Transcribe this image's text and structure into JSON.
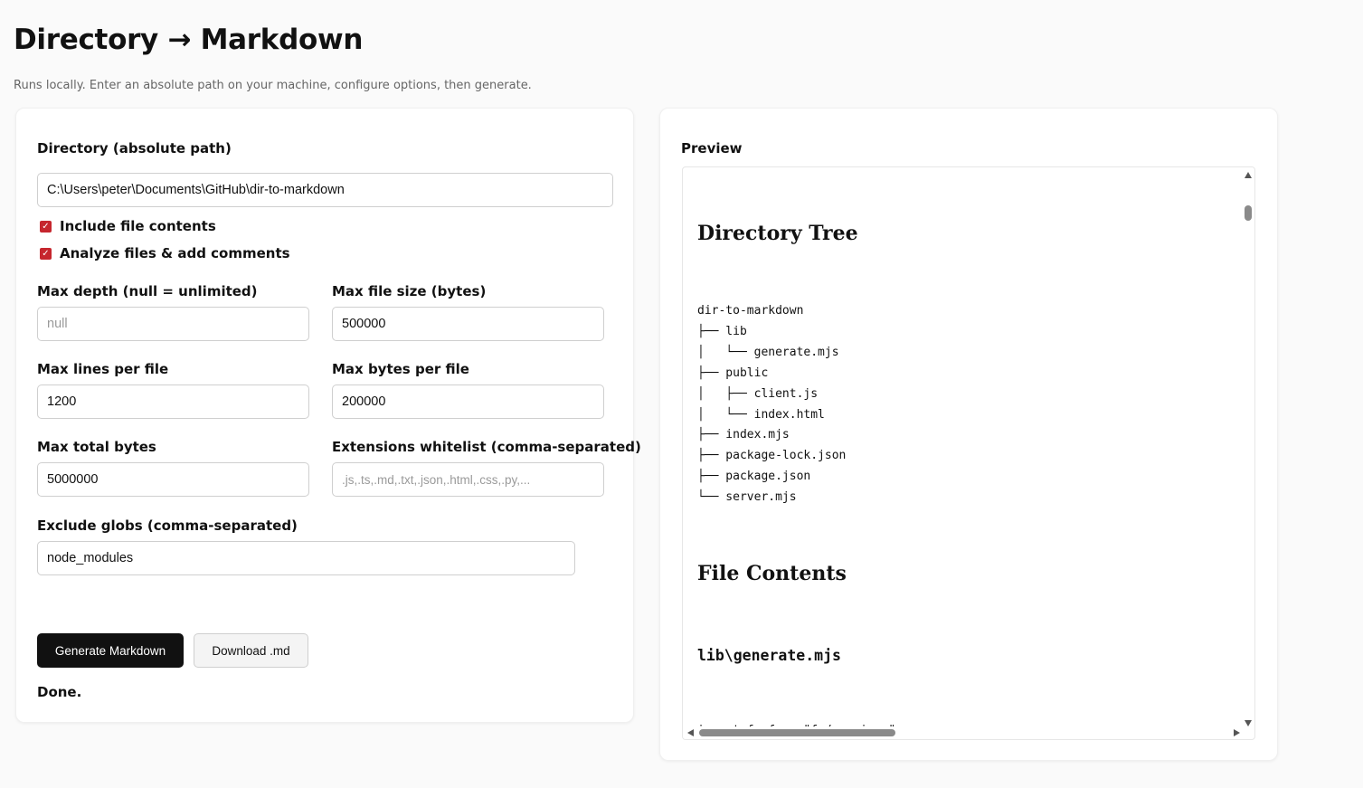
{
  "header": {
    "title": "Directory → Markdown",
    "subtitle": "Runs locally. Enter an absolute path on your machine, configure options, then generate."
  },
  "form": {
    "directory": {
      "label": "Directory (absolute path)",
      "value": "C:\\Users\\peter\\Documents\\GitHub\\dir-to-markdown"
    },
    "include_contents": {
      "label": "Include file contents",
      "checked": true
    },
    "analyze_files": {
      "label": "Analyze files & add comments",
      "checked": true
    },
    "max_depth": {
      "label": "Max depth (null = unlimited)",
      "value": "",
      "placeholder": "null"
    },
    "max_file_size": {
      "label": "Max file size (bytes)",
      "value": "500000"
    },
    "max_lines": {
      "label": "Max lines per file",
      "value": "1200"
    },
    "max_bytes": {
      "label": "Max bytes per file",
      "value": "200000"
    },
    "max_total": {
      "label": "Max total bytes",
      "value": "5000000"
    },
    "extensions": {
      "label": "Extensions whitelist (comma-separated)",
      "value": "",
      "placeholder": ".js,.ts,.md,.txt,.json,.html,.css,.py,..."
    },
    "exclude": {
      "label": "Exclude globs (comma-separated)",
      "value": "node_modules"
    },
    "generate_label": "Generate Markdown",
    "download_label": "Download .md",
    "status": "Done."
  },
  "preview": {
    "label": "Preview",
    "tree_heading": "Directory Tree",
    "tree": "dir-to-markdown\n├── lib\n│   └── generate.mjs\n├── public\n│   ├── client.js\n│   └── index.html\n├── index.mjs\n├── package-lock.json\n├── package.json\n└── server.mjs",
    "contents_heading": "File Contents",
    "file_heading": "lib\\generate.mjs",
    "cut_line": "import fs from \"fs/promises\""
  },
  "colors": {
    "checkbox": "#c6262e",
    "primary_button": "#111111",
    "background": "#fafafa"
  }
}
